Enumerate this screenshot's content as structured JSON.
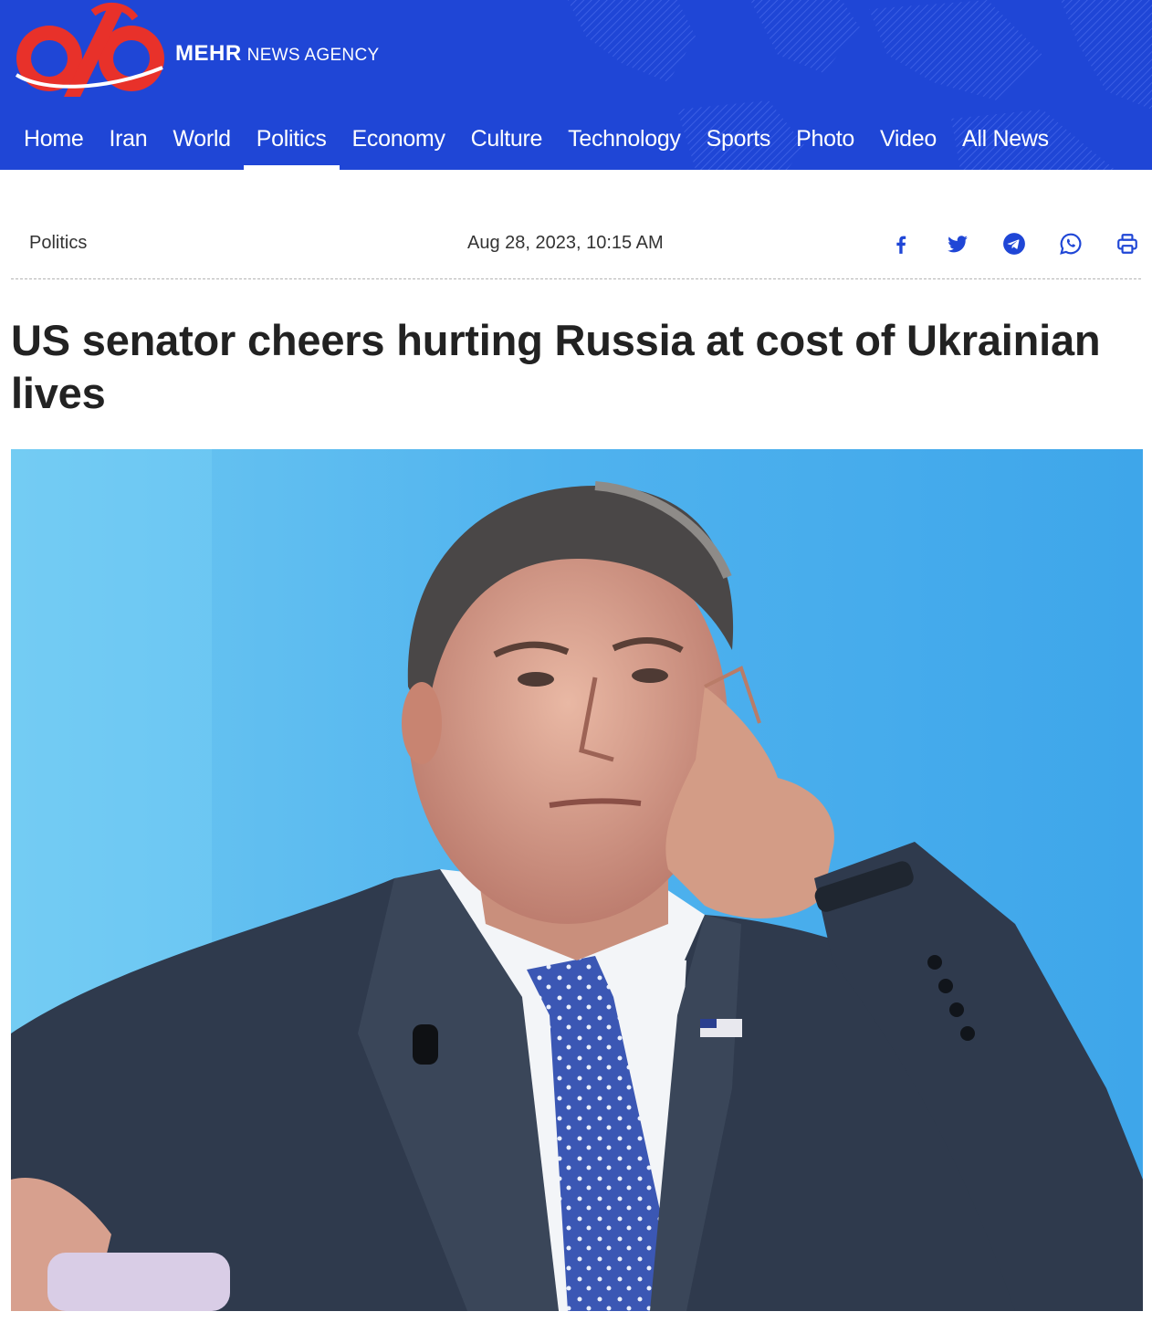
{
  "header": {
    "brand_name": "MEHR",
    "brand_tagline": "NEWS AGENCY",
    "background_color": "#1f46d6",
    "logo_colors": [
      "#e8312a",
      "#ffffff"
    ],
    "nav": [
      {
        "label": "Home",
        "active": false
      },
      {
        "label": "Iran",
        "active": false
      },
      {
        "label": "World",
        "active": false
      },
      {
        "label": "Politics",
        "active": true
      },
      {
        "label": "Economy",
        "active": false
      },
      {
        "label": "Culture",
        "active": false
      },
      {
        "label": "Technology",
        "active": false
      },
      {
        "label": "Sports",
        "active": false
      },
      {
        "label": "Photo",
        "active": false
      },
      {
        "label": "Video",
        "active": false
      },
      {
        "label": "All News",
        "active": false
      }
    ]
  },
  "article": {
    "category": "Politics",
    "date": "Aug 28, 2023, 10:15 AM",
    "title": "US senator cheers hurting Russia at cost of Ukrainian lives",
    "share_icons": [
      "facebook-icon",
      "twitter-icon",
      "telegram-icon",
      "whatsapp-icon",
      "print-icon"
    ],
    "share_color": "#1f46d6"
  }
}
